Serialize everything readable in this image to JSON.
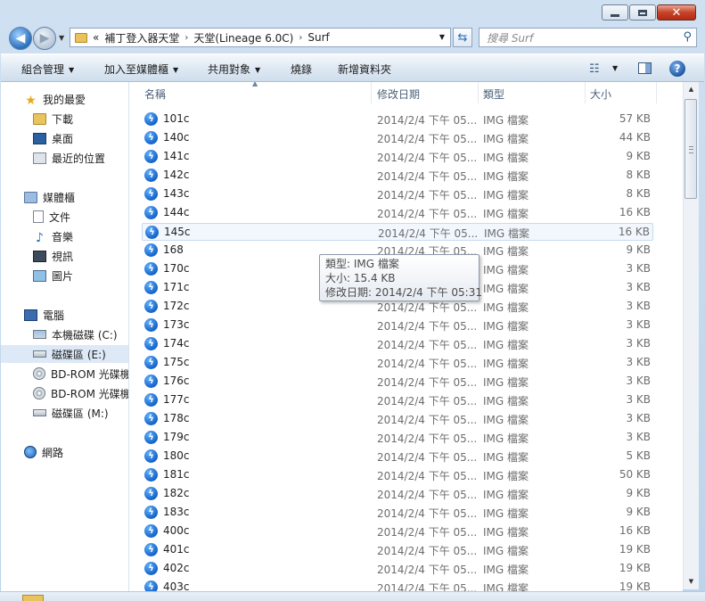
{
  "window": {
    "minimize_icon": "minimize-icon",
    "maximize_icon": "maximize-icon",
    "close_glyph": "✕"
  },
  "address": {
    "overflow": "«",
    "segments": [
      "補丁登入器天堂",
      "天堂(Lineage 6.0C)",
      "Surf"
    ],
    "separator": "›"
  },
  "search": {
    "placeholder": "搜尋 Surf"
  },
  "toolbar": {
    "organize": "組合管理",
    "add_to_library": "加入至媒體櫃",
    "share": "共用對象",
    "burn": "燒錄",
    "new_folder": "新增資料夾"
  },
  "nav": {
    "favorites": "我的最愛",
    "downloads": "下載",
    "desktop": "桌面",
    "recent": "最近的位置",
    "libraries": "媒體櫃",
    "documents": "文件",
    "music": "音樂",
    "videos": "視訊",
    "pictures": "圖片",
    "computer": "電腦",
    "drive_c": "本機磁碟 (C:)",
    "drive_e": "磁碟區 (E:)",
    "bd_rom_1": "BD-ROM 光碟機",
    "bd_rom_2": "BD-ROM 光碟機",
    "drive_m": "磁碟區 (M:)",
    "network": "網路"
  },
  "columns": {
    "name": "名稱",
    "date": "修改日期",
    "type": "類型",
    "size": "大小"
  },
  "files": [
    {
      "name": "101c",
      "date": "2014/2/4 下午 05...",
      "type": "IMG 檔案",
      "size": "57 KB"
    },
    {
      "name": "140c",
      "date": "2014/2/4 下午 05...",
      "type": "IMG 檔案",
      "size": "44 KB"
    },
    {
      "name": "141c",
      "date": "2014/2/4 下午 05...",
      "type": "IMG 檔案",
      "size": "9 KB"
    },
    {
      "name": "142c",
      "date": "2014/2/4 下午 05...",
      "type": "IMG 檔案",
      "size": "8 KB"
    },
    {
      "name": "143c",
      "date": "2014/2/4 下午 05...",
      "type": "IMG 檔案",
      "size": "8 KB"
    },
    {
      "name": "144c",
      "date": "2014/2/4 下午 05...",
      "type": "IMG 檔案",
      "size": "16 KB"
    },
    {
      "name": "145c",
      "date": "2014/2/4 下午 05...",
      "type": "IMG 檔案",
      "size": "16 KB"
    },
    {
      "name": "168",
      "date": "2014/2/4 下午 05...",
      "type": "IMG 檔案",
      "size": "9 KB"
    },
    {
      "name": "170c",
      "date": "2014/2/4 下午 05...",
      "type": "IMG 檔案",
      "size": "3 KB"
    },
    {
      "name": "171c",
      "date": "2014/2/4 下午 05...",
      "type": "IMG 檔案",
      "size": "3 KB"
    },
    {
      "name": "172c",
      "date": "2014/2/4 下午 05...",
      "type": "IMG 檔案",
      "size": "3 KB"
    },
    {
      "name": "173c",
      "date": "2014/2/4 下午 05...",
      "type": "IMG 檔案",
      "size": "3 KB"
    },
    {
      "name": "174c",
      "date": "2014/2/4 下午 05...",
      "type": "IMG 檔案",
      "size": "3 KB"
    },
    {
      "name": "175c",
      "date": "2014/2/4 下午 05...",
      "type": "IMG 檔案",
      "size": "3 KB"
    },
    {
      "name": "176c",
      "date": "2014/2/4 下午 05...",
      "type": "IMG 檔案",
      "size": "3 KB"
    },
    {
      "name": "177c",
      "date": "2014/2/4 下午 05...",
      "type": "IMG 檔案",
      "size": "3 KB"
    },
    {
      "name": "178c",
      "date": "2014/2/4 下午 05...",
      "type": "IMG 檔案",
      "size": "3 KB"
    },
    {
      "name": "179c",
      "date": "2014/2/4 下午 05...",
      "type": "IMG 檔案",
      "size": "3 KB"
    },
    {
      "name": "180c",
      "date": "2014/2/4 下午 05...",
      "type": "IMG 檔案",
      "size": "5 KB"
    },
    {
      "name": "181c",
      "date": "2014/2/4 下午 05...",
      "type": "IMG 檔案",
      "size": "50 KB"
    },
    {
      "name": "182c",
      "date": "2014/2/4 下午 05...",
      "type": "IMG 檔案",
      "size": "9 KB"
    },
    {
      "name": "183c",
      "date": "2014/2/4 下午 05...",
      "type": "IMG 檔案",
      "size": "9 KB"
    },
    {
      "name": "400c",
      "date": "2014/2/4 下午 05...",
      "type": "IMG 檔案",
      "size": "16 KB"
    },
    {
      "name": "401c",
      "date": "2014/2/4 下午 05...",
      "type": "IMG 檔案",
      "size": "19 KB"
    },
    {
      "name": "402c",
      "date": "2014/2/4 下午 05...",
      "type": "IMG 檔案",
      "size": "19 KB"
    },
    {
      "name": "403c",
      "date": "2014/2/4 下午 05...",
      "type": "IMG 檔案",
      "size": "19 KB"
    }
  ],
  "hovered_file_index": 6,
  "tooltip": {
    "type_line": "類型: IMG 檔案",
    "size_line": "大小: 15.4 KB",
    "date_line": "修改日期: 2014/2/4 下午 05:31"
  },
  "icons": {
    "file": "lightning-file-icon"
  }
}
